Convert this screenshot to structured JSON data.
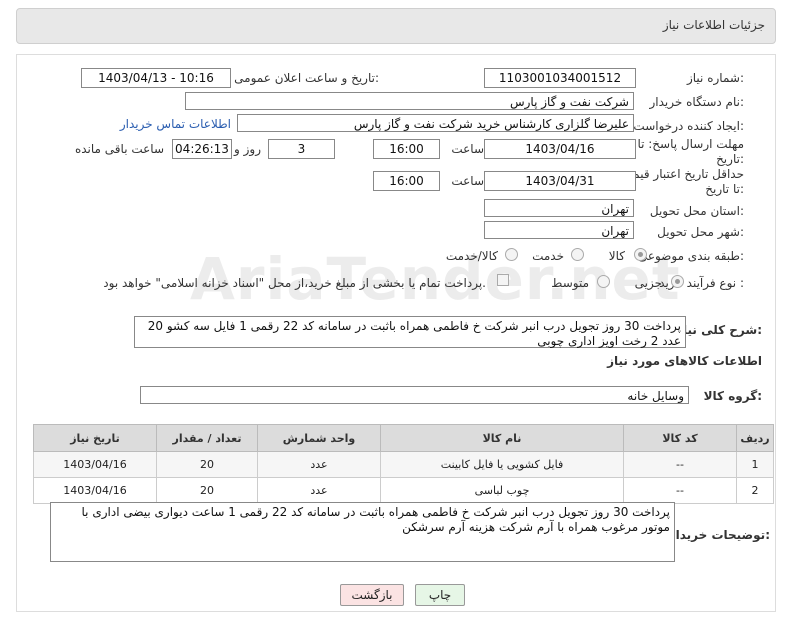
{
  "header": {
    "title": "جزئیات اطلاعات نیاز"
  },
  "form": {
    "need_number_label": "شماره نیاز:",
    "need_number": "1103001034001512",
    "announce_label": "تاریخ و ساعت اعلان عمومی:",
    "announce_value": "1403/04/13 - 10:16",
    "buyer_label": "نام دستگاه خریدار:",
    "buyer": "شرکت نفت و گاز پارس",
    "creator_label": "ایجاد کننده درخواست:",
    "creator": "علیرضا  گلزاری کارشناس خرید  شرکت نفت و گاز پارس",
    "contact_link": "اطلاعات تماس خریدار",
    "deadline_label": "مهلت ارسال پاسخ: تا تاریخ:",
    "deadline_date": "1403/04/16",
    "time_label": "ساعت",
    "deadline_time": "16:00",
    "days_value": "3",
    "days_label": "روز و",
    "remaining_time": "04:26:13",
    "remaining_label": "ساعت باقی مانده",
    "validity_label": "حداقل تاریخ اعتبار قیمت: تا تاریخ:",
    "validity_date": "1403/04/31",
    "validity_time": "16:00",
    "province_label": "استان محل تحویل:",
    "province": "تهران",
    "city_label": "شهر محل تحویل:",
    "city": "تهران",
    "category_label": "طبقه بندی موضوعی:",
    "category_options": [
      "کالا",
      "خدمت",
      "کالا/خدمت"
    ],
    "process_label": "نوع فرآیند خرید :",
    "process_options": [
      "جزیی",
      "متوسط"
    ],
    "process_note": "پرداخت تمام یا بخشی از مبلغ خرید،از محل \"اسناد خزانه اسلامی\" خواهد بود.",
    "description_label": "شرح کلی نیاز:",
    "description": "پرداخت 30 روز تجویل درب انبر شرکت خ فاطمی همراه باثبت در سامانه کد 22 رقمی 1 فایل سه کشو 20 عدد 2 رخت اویز اداری چوبی"
  },
  "goods": {
    "section_title": "اطلاعات کالاهای مورد نیاز",
    "group_label": "گروه کالا:",
    "group": "وسایل خانه",
    "columns": [
      "ردیف",
      "کد کالا",
      "نام کالا",
      "واحد شمارش",
      "تعداد / مقدار",
      "تاریخ نیاز"
    ],
    "rows": [
      [
        "1",
        "--",
        "فایل کشویی یا فایل کابینت",
        "عدد",
        "20",
        "1403/04/16"
      ],
      [
        "2",
        "--",
        "چوب لباسی",
        "عدد",
        "20",
        "1403/04/16"
      ]
    ]
  },
  "buyer_notes": {
    "label": "توضیحات خریدار:",
    "text": "پرداخت 30 روز تجویل درب انبر شرکت خ فاطمی همراه باثبت در سامانه کد 22 رقمی 1 ساعت دیواری بیضی اداری با موتور مرغوب همراه با آرم شرکت هزینه آرم سرشکن"
  },
  "buttons": {
    "print": "چاپ",
    "back": "بازگشت"
  },
  "watermark": "AriaTender.net",
  "colors": {
    "link": "#2a5db0",
    "print_bg": "#e6f6e6",
    "back_bg": "#fbe3e3"
  }
}
